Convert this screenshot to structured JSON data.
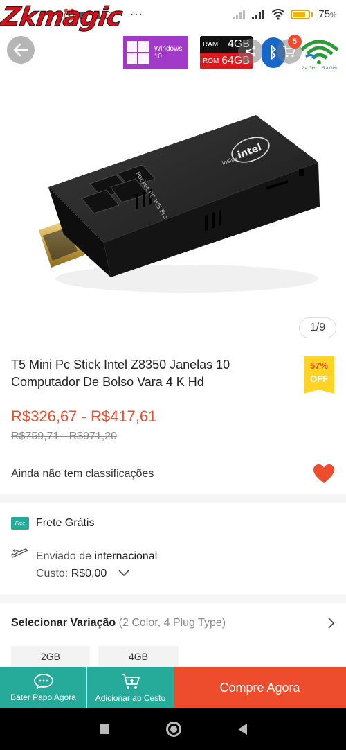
{
  "watermark": {
    "text": "Zkmagic"
  },
  "status_bar": {
    "left_icons": "⏰ ◼ ◼ S",
    "more": "···",
    "battery_percent": "75",
    "battery_suffix": "%"
  },
  "badges": {
    "windows_text": "Windows 10",
    "ram_label": "RAM",
    "ram_value": "4GB",
    "rom_label": "ROM",
    "rom_value": "64GB",
    "cart_count": "5",
    "wifi_24": "2.4 GHz",
    "wifi_58": "5.8 GHz"
  },
  "product_image": {
    "brand_text": "intel",
    "brand_sub": "inside™",
    "model_text": "Pocket PC W5 Pro"
  },
  "image_counter": "1/9",
  "product": {
    "title": "T5 Mini Pc Stick Intel Z8350 Janelas 10 Computador De Bolso Vara 4 K Hd",
    "discount_pct": "57%",
    "discount_label": "OFF",
    "price_range": "R$326,67 - R$417,61",
    "original_price_range": "R$759,71 - R$971,20",
    "rating_text": "Ainda não tem classificações"
  },
  "shipping": {
    "free_badge": "Free",
    "free_text": "Frete Grátis",
    "from_prefix": "Enviado de",
    "from_place": "internacional",
    "cost_label": "Custo:",
    "cost_value": "R$0,00"
  },
  "variation": {
    "title": "Selecionar Variação",
    "subtitle": "(2 Color, 4 Plug Type)",
    "options": [
      "2GB",
      "4GB"
    ]
  },
  "actions": {
    "chat_label": "Bater Papo Agora",
    "cart_label": "Adicionar ao Cesto",
    "buy_label": "Compre Agora"
  },
  "colors": {
    "accent": "#ee4d2d",
    "teal": "#26aa99",
    "badge_yellow": "#ffd424"
  }
}
